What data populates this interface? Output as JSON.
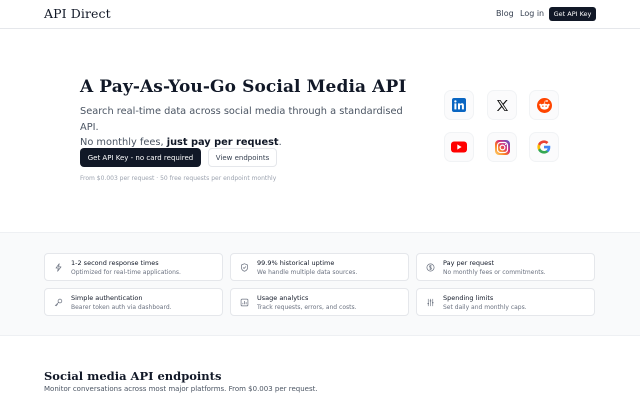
{
  "header": {
    "logo": "API Direct",
    "nav": {
      "blog": "Blog",
      "login": "Log in",
      "cta": "Get API Key"
    }
  },
  "hero": {
    "title": "A Pay-As-You-Go Social Media API",
    "subtitle_line1": "Search real-time data across social media through a standardised API.",
    "subtitle_line2_pre": "No monthly fees, ",
    "subtitle_line2_bold": "just pay per request",
    "subtitle_line2_post": ".",
    "primary_button": "Get API Key - no card required",
    "secondary_button": "View endpoints",
    "note": "From $0.003 per request · 50 free requests per endpoint monthly"
  },
  "platform_logos": [
    {
      "name": "linkedin-icon",
      "color": "#0a66c2"
    },
    {
      "name": "x-icon",
      "color": "#111111"
    },
    {
      "name": "reddit-icon",
      "color": "#ff4500"
    },
    {
      "name": "youtube-icon",
      "color": "#ff0000"
    },
    {
      "name": "instagram-icon",
      "color": "#d62976"
    },
    {
      "name": "google-icon",
      "color": "#4285f4"
    }
  ],
  "features": [
    {
      "icon": "lightning-icon",
      "title": "1-2 second response times",
      "desc": "Optimized for real-time applications."
    },
    {
      "icon": "shield-icon",
      "title": "99.9% historical uptime",
      "desc": "We handle multiple data sources."
    },
    {
      "icon": "coin-icon",
      "title": "Pay per request",
      "desc": "No monthly fees or commitments."
    },
    {
      "icon": "key-icon",
      "title": "Simple authentication",
      "desc": "Bearer token auth via dashboard."
    },
    {
      "icon": "chart-icon",
      "title": "Usage analytics",
      "desc": "Track requests, errors, and costs."
    },
    {
      "icon": "sliders-icon",
      "title": "Spending limits",
      "desc": "Set daily and monthly caps."
    }
  ],
  "endpoints": {
    "title": "Social media API endpoints",
    "subtitle": "Monitor conversations across most major platforms. From $0.003 per request."
  }
}
